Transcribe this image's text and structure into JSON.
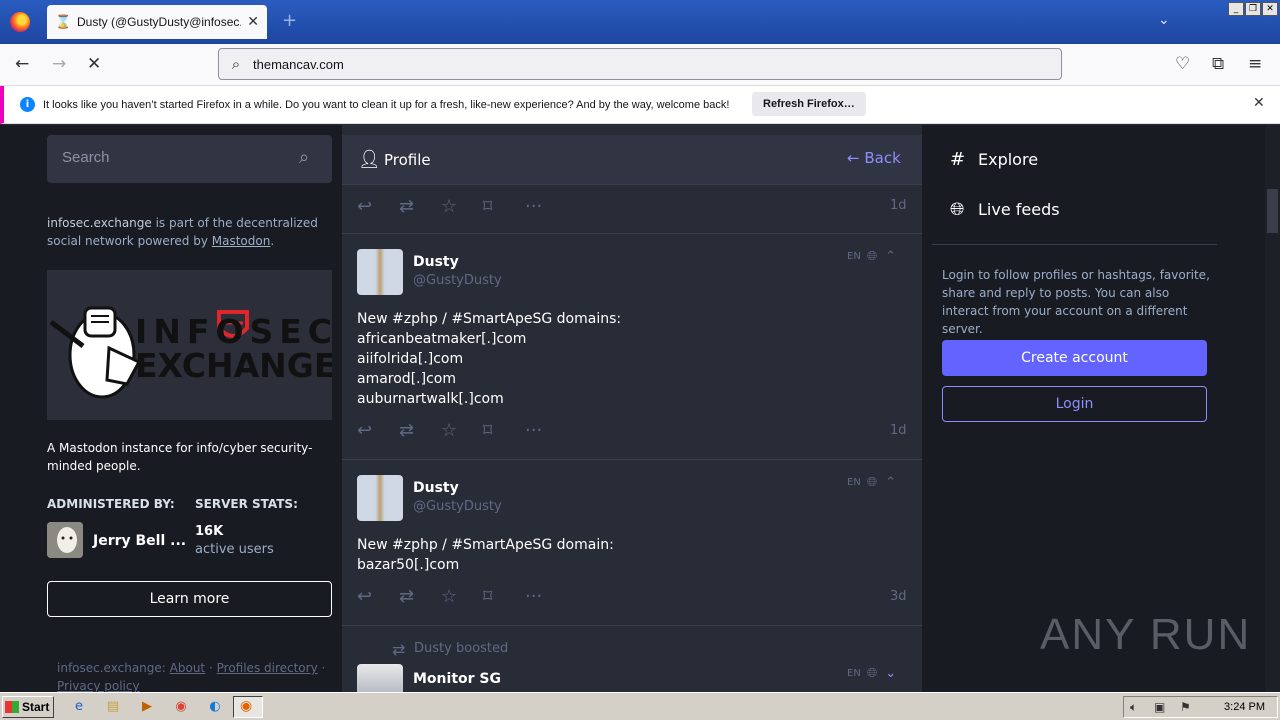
{
  "browser": {
    "tab_title": "Dusty (@GustyDusty@infosec.exchange)",
    "tab_close": "✕",
    "new_tab": "+",
    "url": "themancav.com",
    "notification": {
      "message": "It looks like you haven’t started Firefox in a while. Do you want to clean it up for a fresh, like-new experience? And by the way, welcome back!",
      "button": "Refresh Firefox…"
    }
  },
  "sidebar": {
    "search_placeholder": "Search",
    "about_domain": "infosec.exchange",
    "about_text": " is part of the decentralized social network powered by ",
    "about_link": "Mastodon",
    "about_end": ".",
    "banner_line1": "INFOSEC",
    "banner_line2": "EXCHANGE",
    "description": "A Mastodon instance for info/cyber security-minded people.",
    "administered_by": "ADMINISTERED BY:",
    "server_stats": "SERVER STATS:",
    "admin_name": "Jerry Bell ...",
    "stat_number": "16K",
    "stat_label": "active users",
    "learn_more": "Learn more",
    "footer": {
      "domain": "infosec.exchange:",
      "about": "About",
      "profiles": "Profiles directory",
      "sep": "·",
      "privacy": "Privacy policy"
    }
  },
  "column": {
    "title": "Profile",
    "back": "Back"
  },
  "statuses": [
    {
      "time": "1d"
    },
    {
      "name": "Dusty",
      "handle": "@GustyDusty",
      "lang": "EN",
      "lines": [
        "New #zphp / #SmartApeSG domains:",
        "africanbeatmaker[.]com",
        "aiifolrida[.]com",
        "amarod[.]com",
        "auburnartwalk[.]com"
      ],
      "time": "1d"
    },
    {
      "name": "Dusty",
      "handle": "@GustyDusty",
      "lang": "EN",
      "lines": [
        "New #zphp / #SmartApeSG domain:",
        "bazar50[.]com"
      ],
      "time": "3d"
    },
    {
      "boosted_by": "Dusty boosted",
      "name": "Monitor SG",
      "lang": "EN"
    }
  ],
  "right": {
    "explore": "Explore",
    "live_feeds": "Live feeds",
    "signin_text": "Login to follow profiles or hashtags, favorite, share and reply to posts. You can also interact from your account on a different server.",
    "create_account": "Create account",
    "login": "Login"
  },
  "watermark": "ANY RUN",
  "taskbar": {
    "start": "Start",
    "clock": "3:24 PM"
  },
  "colors": {
    "accent": "#6364ff",
    "link": "#8c8dff",
    "bg": "#191b22",
    "column": "#282c37"
  }
}
